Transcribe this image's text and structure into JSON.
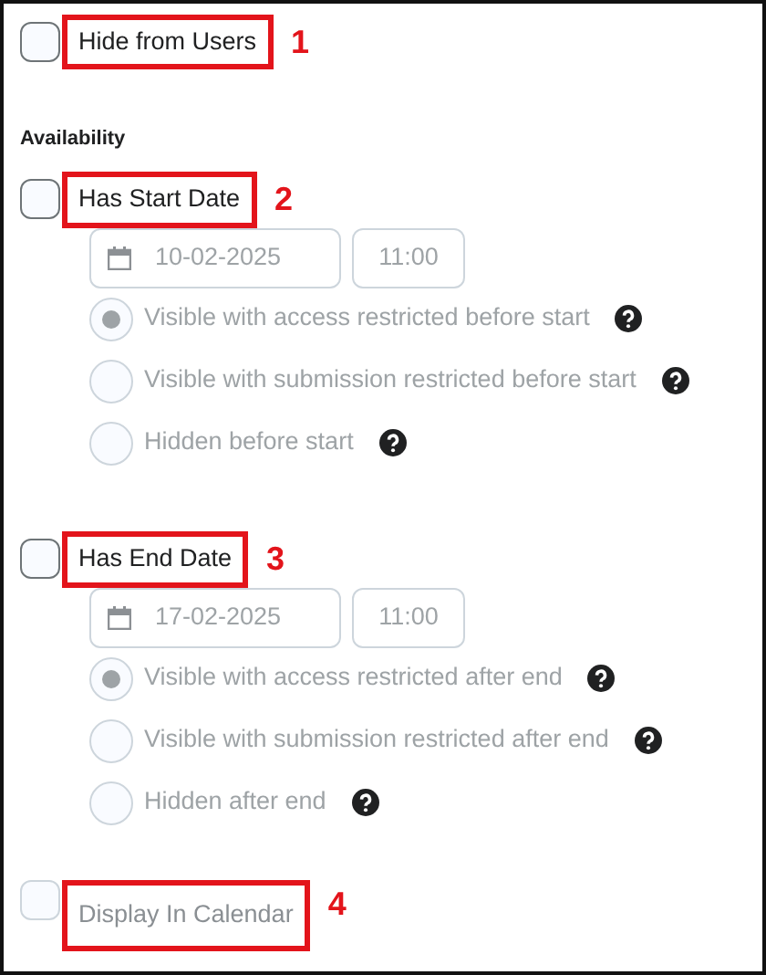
{
  "hide_from_users": {
    "label": "Hide from Users",
    "checked": false,
    "disabled": false,
    "callout": "1"
  },
  "availability": {
    "heading": "Availability",
    "start": {
      "label": "Has Start Date",
      "checked": false,
      "disabled": false,
      "callout": "2",
      "date": "10-02-2025",
      "time": "11:00",
      "options_disabled": true,
      "options": [
        {
          "label": "Visible with access restricted before start",
          "selected": true
        },
        {
          "label": "Visible with submission restricted before start",
          "selected": false
        },
        {
          "label": "Hidden before start",
          "selected": false
        }
      ]
    },
    "end": {
      "label": "Has End Date",
      "checked": false,
      "disabled": false,
      "callout": "3",
      "date": "17-02-2025",
      "time": "11:00",
      "options_disabled": true,
      "options": [
        {
          "label": "Visible with access restricted after end",
          "selected": true
        },
        {
          "label": "Visible with submission restricted after end",
          "selected": false
        },
        {
          "label": "Hidden after end",
          "selected": false
        }
      ]
    }
  },
  "display_in_calendar": {
    "label": "Display In Calendar",
    "checked": false,
    "disabled": true,
    "callout": "4"
  }
}
